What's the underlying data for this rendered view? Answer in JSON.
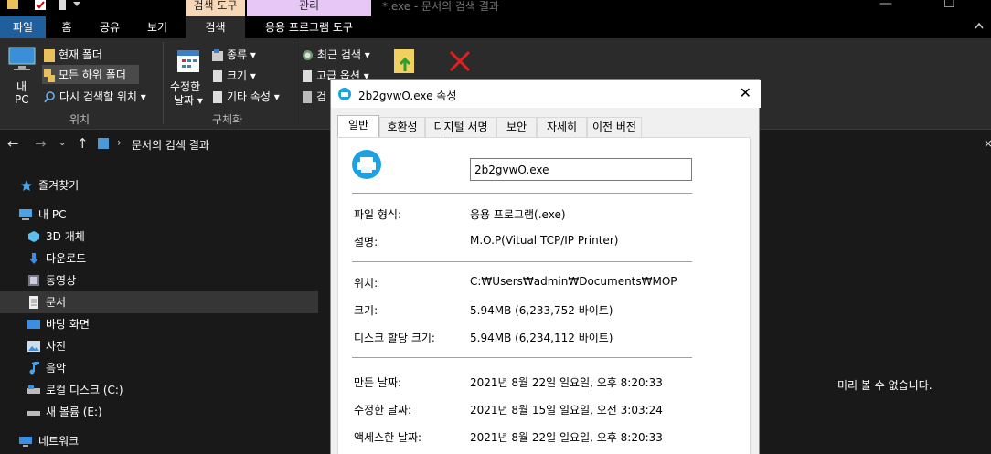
{
  "window": {
    "title": "*.exe - 문서의 검색 결과",
    "context_tab_search": "검색 도구",
    "context_tab_manage": "관리"
  },
  "ribbon_tabs": {
    "file": "파일",
    "home": "홈",
    "share": "공유",
    "view": "보기",
    "search": "검색",
    "app_tools": "응용 프로그램 도구"
  },
  "ribbon": {
    "this_pc_line1": "내",
    "this_pc_line2": "PC",
    "current_folder": "현재 폴더",
    "all_subfolders": "모든 하위 폴더",
    "search_again": "다시 검색할 위치",
    "group_location": "위치",
    "date_modified_line1": "수정한",
    "date_modified_line2": "날짜",
    "kind": "종류",
    "size": "크기",
    "other_props": "기타 속성",
    "group_refine": "구체화",
    "recent_searches": "최근 검색",
    "advanced_options": "고급 옵션",
    "save_search": "검"
  },
  "address": {
    "path": "문서의 검색 결과",
    "separator": "›"
  },
  "nav": {
    "items": [
      {
        "label": "즐겨찾기",
        "icon": "star-icon"
      },
      {
        "label": "내 PC",
        "icon": "computer-icon"
      },
      {
        "label": "3D 개체",
        "icon": "cube-icon"
      },
      {
        "label": "다운로드",
        "icon": "download-icon"
      },
      {
        "label": "동영상",
        "icon": "video-icon"
      },
      {
        "label": "문서",
        "icon": "document-icon"
      },
      {
        "label": "바탕 화면",
        "icon": "desktop-icon"
      },
      {
        "label": "사진",
        "icon": "picture-icon"
      },
      {
        "label": "음악",
        "icon": "music-icon"
      },
      {
        "label": "로컬 디스크 (C:)",
        "icon": "drive-icon"
      },
      {
        "label": "새 볼륨 (E:)",
        "icon": "drive-icon"
      },
      {
        "label": "네트워크",
        "icon": "network-icon"
      }
    ]
  },
  "preview": {
    "message": "미리 볼 수 없습니다."
  },
  "dialog": {
    "title": "2b2gvwO.exe 속성",
    "close": "✕",
    "tabs": [
      "일반",
      "호환성",
      "디지털 서명",
      "보안",
      "자세히",
      "이전 버전"
    ],
    "filename": "2b2gvwO.exe",
    "props": {
      "type_label": "파일 형식:",
      "type_value": "응용 프로그램(.exe)",
      "desc_label": "설명:",
      "desc_value": "M.O.P(Vitual TCP/IP Printer)",
      "location_label": "위치:",
      "location_value": "C:₩Users₩admin₩Documents₩MOP",
      "size_label": "크기:",
      "size_value": "5.94MB (6,233,752 바이트)",
      "disk_label": "디스크 할당 크기:",
      "disk_value": "5.94MB (6,234,112 바이트)",
      "created_label": "만든 날짜:",
      "created_value": "2021년 8월 22일 일요일, 오후 8:20:33",
      "modified_label": "수정한 날짜:",
      "modified_value": "2021년 8월 15일 일요일, 오전 3:03:24",
      "accessed_label": "액세스한 날짜:",
      "accessed_value": "2021년 8월 22일 일요일, 오후 8:20:33"
    }
  },
  "colors": {
    "file_tab": "#1f5f9e",
    "search_context": "#f6d8b8",
    "manage_context": "#e7c7f5",
    "app_icon": "#1ea1e0"
  }
}
